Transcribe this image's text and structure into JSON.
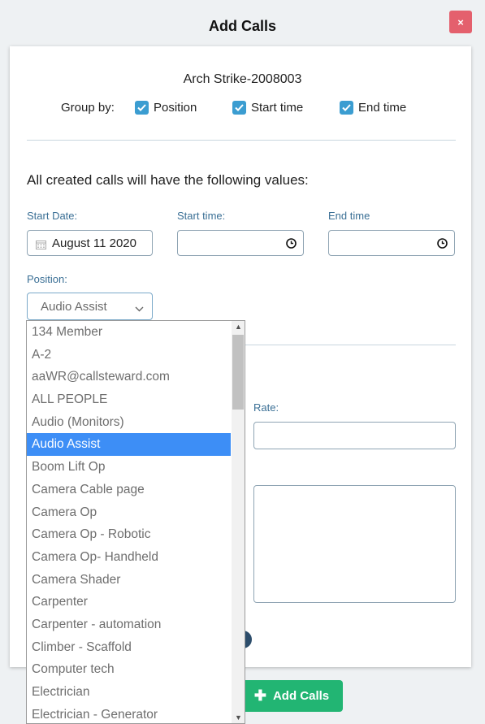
{
  "modal": {
    "title": "Add Calls",
    "close_label": "×"
  },
  "record": {
    "name": "Arch Strike-2008003"
  },
  "group_by": {
    "label": "Group by:",
    "options": [
      {
        "label": "Position",
        "checked": true
      },
      {
        "label": "Start time",
        "checked": true
      },
      {
        "label": "End time",
        "checked": true
      }
    ]
  },
  "form": {
    "info_text": "All created calls will have the following values:",
    "start_date_label": "Start Date:",
    "start_date_value": "August 11 2020",
    "start_time_label": "Start time:",
    "end_time_label": "End time",
    "position_label": "Position:",
    "position_value": "Audio Assist",
    "rate_label": "Rate:"
  },
  "position_dropdown": {
    "selected": "Audio Assist",
    "options": [
      "134 Member",
      "A-2",
      "aaWR@callsteward.com",
      "ALL PEOPLE",
      "Audio (Monitors)",
      "Audio Assist",
      "Boom Lift Op",
      "Camera Cable page",
      "Camera Op",
      "Camera Op - Robotic",
      "Camera Op- Handheld",
      "Camera Shader",
      "Carpenter",
      "Carpenter - automation",
      "Climber - Scaffold",
      "Computer tech",
      "Electrician",
      "Electrician - Generator"
    ]
  },
  "footer": {
    "add_calls_label": "Add Calls"
  },
  "colors": {
    "accent_blue": "#3b9dd1",
    "selected_option": "#3d8ef6",
    "add_button": "#22b573",
    "close_button": "#e4606d",
    "label_blue": "#3a6f95"
  }
}
